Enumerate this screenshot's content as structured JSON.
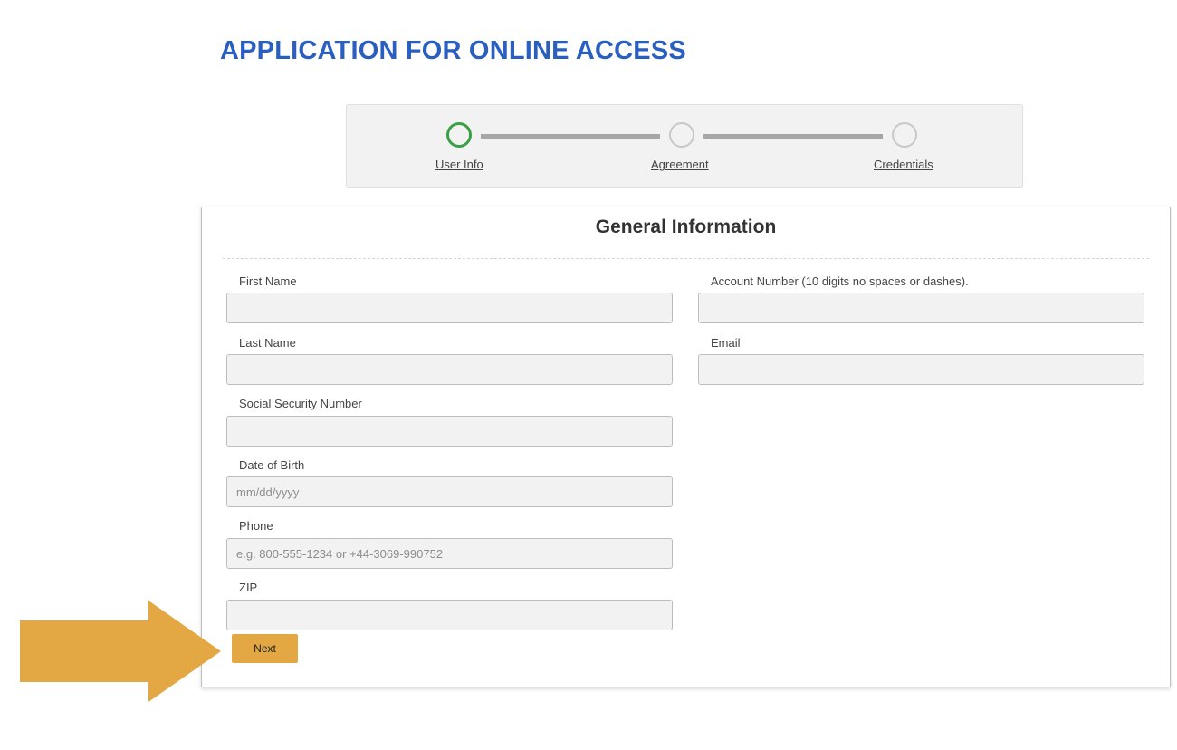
{
  "page": {
    "title": "APPLICATION FOR ONLINE ACCESS"
  },
  "colors": {
    "title": "#2a5fc2",
    "accent": "#e3a843",
    "active_step": "#3aa046",
    "inactive_step": "#c8c8c8"
  },
  "stepper": {
    "steps": [
      {
        "label": "User Info",
        "state": "active"
      },
      {
        "label": "Agreement",
        "state": "inactive"
      },
      {
        "label": "Credentials",
        "state": "inactive"
      }
    ]
  },
  "form": {
    "heading": "General Information",
    "fields": {
      "first_name": {
        "label": "First Name",
        "value": "",
        "placeholder": ""
      },
      "last_name": {
        "label": "Last Name",
        "value": "",
        "placeholder": ""
      },
      "ssn": {
        "label": "Social Security Number",
        "value": "",
        "placeholder": ""
      },
      "dob": {
        "label": "Date of Birth",
        "value": "",
        "placeholder": "mm/dd/yyyy"
      },
      "phone": {
        "label": "Phone",
        "value": "",
        "placeholder": "e.g. 800-555-1234 or +44-3069-990752"
      },
      "zip": {
        "label": "ZIP",
        "value": "",
        "placeholder": ""
      },
      "account_number": {
        "label": "Account Number (10 digits no spaces or dashes).",
        "value": "",
        "placeholder": ""
      },
      "email": {
        "label": "Email",
        "value": "",
        "placeholder": ""
      }
    },
    "next_label": "Next"
  },
  "annotation": {
    "icon": "arrow-right-icon"
  }
}
